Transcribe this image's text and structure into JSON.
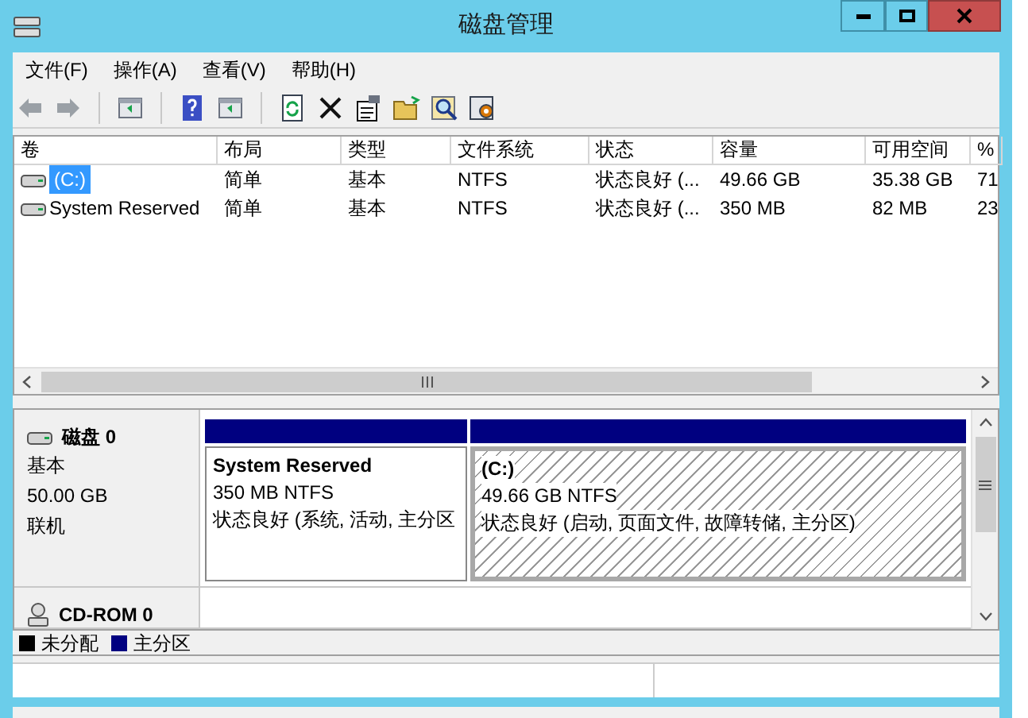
{
  "window": {
    "title": "磁盘管理"
  },
  "menu": [
    "文件(F)",
    "操作(A)",
    "查看(V)",
    "帮助(H)"
  ],
  "toolbar": [
    {
      "kind": "back",
      "disabled": true
    },
    {
      "kind": "forward",
      "disabled": true
    },
    {
      "kind": "sep"
    },
    {
      "kind": "pane",
      "disabled": false
    },
    {
      "kind": "sep"
    },
    {
      "kind": "help",
      "disabled": false
    },
    {
      "kind": "pane",
      "disabled": false
    },
    {
      "kind": "sep"
    },
    {
      "kind": "refresh",
      "disabled": false
    },
    {
      "kind": "delete",
      "disabled": false
    },
    {
      "kind": "properties",
      "disabled": false
    },
    {
      "kind": "open",
      "disabled": false
    },
    {
      "kind": "search",
      "disabled": false
    },
    {
      "kind": "settings",
      "disabled": false
    }
  ],
  "table": {
    "columns": [
      "卷",
      "布局",
      "类型",
      "文件系统",
      "状态",
      "容量",
      "可用空间",
      "%"
    ],
    "rows": [
      {
        "selected": true,
        "cells": [
          "(C:)",
          "简单",
          "基本",
          "NTFS",
          "状态良好 (...",
          "49.66 GB",
          "35.38 GB",
          "71"
        ]
      },
      {
        "selected": false,
        "cells": [
          "System Reserved",
          "简单",
          "基本",
          "NTFS",
          "状态良好 (...",
          "350 MB",
          "82 MB",
          "23"
        ]
      }
    ]
  },
  "disks": [
    {
      "kind": "disk",
      "name": "磁盘 0",
      "lines": [
        "基本",
        "50.00 GB",
        "联机"
      ],
      "partitions": [
        {
          "name": "System Reserved",
          "size": "350 MB NTFS",
          "status": "状态良好 (系统, 活动, 主分区",
          "selected": false,
          "color": "#000080"
        },
        {
          "name": "(C:)",
          "size": "49.66 GB NTFS",
          "status": "状态良好 (启动, 页面文件, 故障转储, 主分区)",
          "selected": true,
          "color": "#000080"
        }
      ]
    },
    {
      "kind": "cdrom",
      "name": "CD-ROM 0"
    }
  ],
  "legend": [
    {
      "label": "未分配",
      "color": "#000000"
    },
    {
      "label": "主分区",
      "color": "#000080"
    }
  ]
}
